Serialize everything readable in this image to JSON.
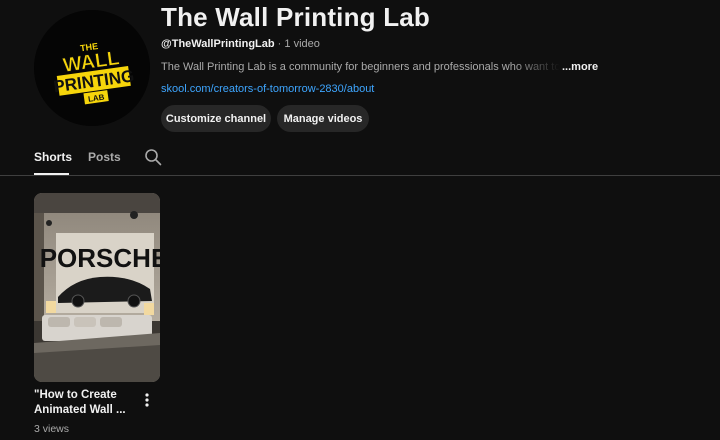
{
  "channel": {
    "name": "The Wall Printing Lab",
    "handle": "@TheWallPrintingLab",
    "separator": "·",
    "video_count": "1 video",
    "description": "The Wall Printing Lab is a community for beginners and professionals who want to design",
    "more_label": "...more",
    "link": "skool.com/creators-of-tomorrow-2830/about",
    "logo_lines": [
      "THE",
      "WALL",
      "PRINTING",
      "LAB"
    ],
    "brand_color": "#f6d50b"
  },
  "actions": {
    "customize_label": "Customize channel",
    "manage_label": "Manage videos"
  },
  "tabs": [
    {
      "label": "Shorts",
      "active": true
    },
    {
      "label": "Posts",
      "active": false
    }
  ],
  "search_icon": "search-icon",
  "shorts": [
    {
      "title": "\"How to Create Animated Wall ...",
      "views": "3 views",
      "thumbnail_text": "PORSCHE"
    }
  ]
}
